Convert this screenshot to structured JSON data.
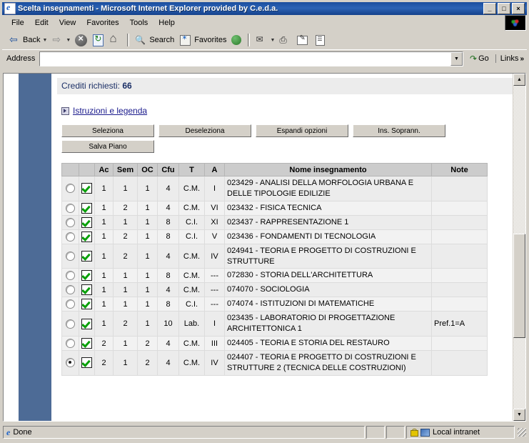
{
  "window": {
    "title": "Scelta insegnamenti - Microsoft Internet Explorer provided by C.e.d.a.",
    "minimize": "_",
    "maximize": "□",
    "close": "×"
  },
  "menu": {
    "items": [
      "File",
      "Edit",
      "View",
      "Favorites",
      "Tools",
      "Help"
    ]
  },
  "toolbar": {
    "back": "Back",
    "forward": "",
    "search": "Search",
    "favorites": "Favorites",
    "dropdown_arrow": "▼"
  },
  "address": {
    "label": "Address",
    "value": "",
    "placeholder": "",
    "go": "Go",
    "links": "Links",
    "links_chevron": "»",
    "dropdown_arrow": "▼"
  },
  "page": {
    "credits_label": "Crediti richiesti:",
    "credits_value": "66",
    "legend_link": "Istruzioni e legenda",
    "buttons": {
      "seleziona": "Seleziona",
      "deseleziona": "Deseleziona",
      "espandi": "Espandi opzioni",
      "soprann": "Ins. Soprann.",
      "salva": "Salva Piano"
    },
    "table": {
      "headers": [
        "",
        "",
        "Ac",
        "Sem",
        "OC",
        "Cfu",
        "T",
        "A",
        "Nome insegnamento",
        "Note"
      ],
      "rows": [
        {
          "radio": false,
          "checked": true,
          "ac": "1",
          "sem": "1",
          "oc": "1",
          "cfu": "4",
          "t": "C.M.",
          "a": "I",
          "nome": "023429 - ANALISI DELLA MORFOLOGIA URBANA E DELLE TIPOLOGIE EDILIZIE",
          "note": ""
        },
        {
          "radio": false,
          "checked": true,
          "ac": "1",
          "sem": "2",
          "oc": "1",
          "cfu": "4",
          "t": "C.M.",
          "a": "VI",
          "nome": "023432 - FISICA TECNICA",
          "note": ""
        },
        {
          "radio": false,
          "checked": true,
          "ac": "1",
          "sem": "1",
          "oc": "1",
          "cfu": "8",
          "t": "C.I.",
          "a": "XI",
          "nome": "023437 - RAPPRESENTAZIONE 1",
          "note": ""
        },
        {
          "radio": false,
          "checked": true,
          "ac": "1",
          "sem": "2",
          "oc": "1",
          "cfu": "8",
          "t": "C.I.",
          "a": "V",
          "nome": "023436 - FONDAMENTI DI TECNOLOGIA",
          "note": ""
        },
        {
          "radio": false,
          "checked": true,
          "ac": "1",
          "sem": "2",
          "oc": "1",
          "cfu": "4",
          "t": "C.M.",
          "a": "IV",
          "nome": "024941 - TEORIA E PROGETTO DI COSTRUZIONI E STRUTTURE",
          "note": ""
        },
        {
          "radio": false,
          "checked": true,
          "ac": "1",
          "sem": "1",
          "oc": "1",
          "cfu": "8",
          "t": "C.M.",
          "a": "---",
          "nome": "072830 - STORIA DELL'ARCHITETTURA",
          "note": ""
        },
        {
          "radio": false,
          "checked": true,
          "ac": "1",
          "sem": "1",
          "oc": "1",
          "cfu": "4",
          "t": "C.M.",
          "a": "---",
          "nome": "074070 - SOCIOLOGIA",
          "note": ""
        },
        {
          "radio": false,
          "checked": true,
          "ac": "1",
          "sem": "1",
          "oc": "1",
          "cfu": "8",
          "t": "C.I.",
          "a": "---",
          "nome": "074074 - ISTITUZIONI DI MATEMATICHE",
          "note": ""
        },
        {
          "radio": false,
          "checked": true,
          "ac": "1",
          "sem": "2",
          "oc": "1",
          "cfu": "10",
          "t": "Lab.",
          "a": "I",
          "nome": "023435 - LABORATORIO DI PROGETTAZIONE ARCHITETTONICA 1",
          "note": "Pref.1=A"
        },
        {
          "radio": false,
          "checked": true,
          "ac": "2",
          "sem": "1",
          "oc": "2",
          "cfu": "4",
          "t": "C.M.",
          "a": "III",
          "nome": "024405 - TEORIA E STORIA DEL RESTAURO",
          "note": ""
        },
        {
          "radio": true,
          "checked": true,
          "ac": "2",
          "sem": "1",
          "oc": "2",
          "cfu": "4",
          "t": "C.M.",
          "a": "IV",
          "nome": "024407 - TEORIA E PROGETTO DI COSTRUZIONI E STRUTTURE 2 (TECNICA DELLE COSTRUZIONI)",
          "note": ""
        }
      ]
    }
  },
  "scrollbar": {
    "up_arrow": "▲",
    "down_arrow": "▼"
  },
  "status": {
    "text": "Done",
    "zone": "Local intranet"
  }
}
